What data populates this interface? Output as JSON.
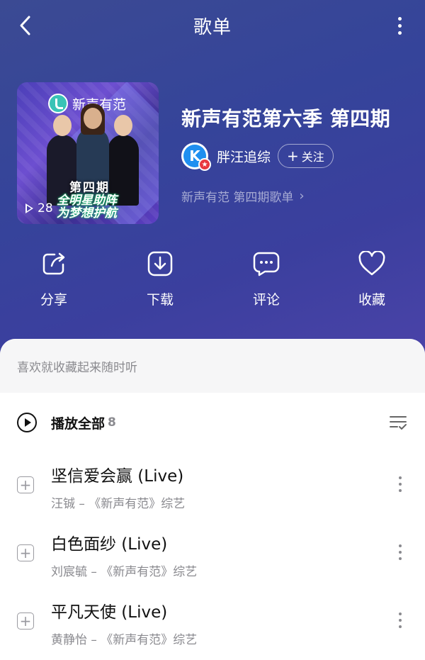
{
  "header": {
    "title": "歌单"
  },
  "cover": {
    "logo_text": "新声有范",
    "episode_text": "第四期",
    "slogan_line1": "全明星助阵",
    "slogan_line2": "为梦想护航",
    "play_count": "28"
  },
  "playlist": {
    "title": "新声有范第六季 第四期",
    "author": "胖汪追综",
    "author_avatar_letter": "K",
    "follow_label": "关注",
    "subtitle": "新声有范 第四期歌单"
  },
  "actions": [
    {
      "label": "分享",
      "icon": "share-icon"
    },
    {
      "label": "下载",
      "icon": "download-icon"
    },
    {
      "label": "评论",
      "icon": "comment-icon"
    },
    {
      "label": "收藏",
      "icon": "heart-icon"
    }
  ],
  "sheet": {
    "tip": "喜欢就收藏起来随时听",
    "play_all_label": "播放全部",
    "play_all_count": "8"
  },
  "songs": [
    {
      "title": "坚信爱会赢 (Live)",
      "meta": "汪铖 – 《新声有范》综艺"
    },
    {
      "title": "白色面纱 (Live)",
      "meta": "刘宸毓 – 《新声有范》综艺"
    },
    {
      "title": "平凡天使 (Live)",
      "meta": "黄静怡 – 《新声有范》综艺"
    }
  ],
  "colors": {
    "header_bg": "#3a469a",
    "avatar_blue": "#1f8ff0",
    "badge_red": "#e8373f",
    "muted_text": "#8a8a8f"
  }
}
